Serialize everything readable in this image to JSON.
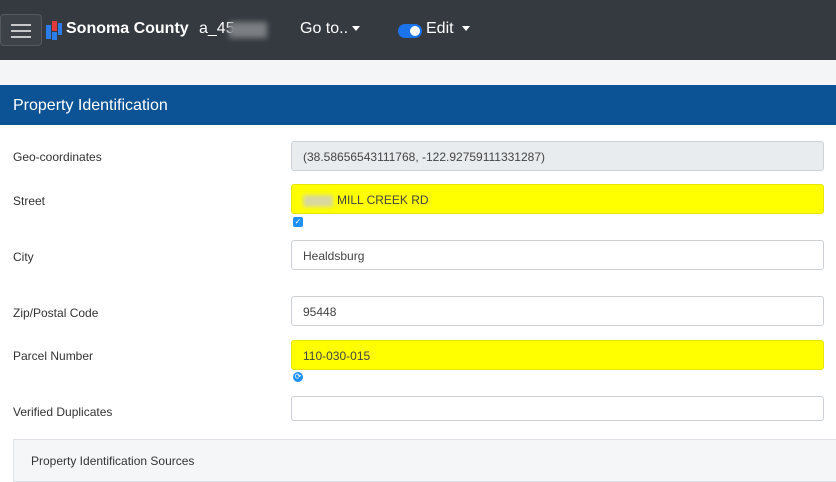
{
  "nav": {
    "brand": "Sonoma County",
    "user": "a_45",
    "goto_label": "Go to..",
    "edit_label": "Edit",
    "edit_toggle_on": true,
    "accent": "#1a73e8"
  },
  "section": {
    "title": "Property Identification",
    "color": "#0b5394"
  },
  "fields": {
    "geo": {
      "label": "Geo-coordinates",
      "value": "(38.58656543111768, -122.92759111331287)"
    },
    "street": {
      "label": "Street",
      "value": "MILL CREEK RD"
    },
    "city": {
      "label": "City",
      "value": "Healdsburg"
    },
    "zip": {
      "label": "Zip/Postal Code",
      "value": "95448"
    },
    "parcel": {
      "label": "Parcel Number",
      "value": "110-030-015"
    },
    "duplicates": {
      "label": "Verified Duplicates",
      "value": ""
    }
  },
  "highlight_color": "#ffff00",
  "sources": {
    "title": "Property Identification Sources"
  }
}
